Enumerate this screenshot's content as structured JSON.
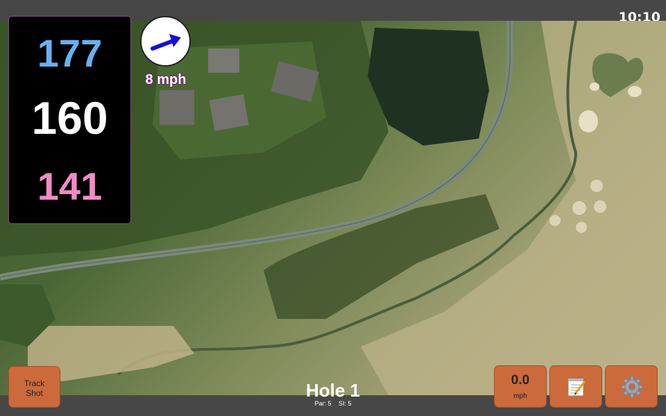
{
  "status_bar": {
    "time": "10:10"
  },
  "distances": {
    "back": "177",
    "center": "160",
    "front": "141"
  },
  "wind": {
    "speed": "8 mph",
    "icon": "wind-direction-arrow-icon"
  },
  "buttons": {
    "track_shot": {
      "line1": "Track",
      "line2": "Shot"
    },
    "speed": {
      "value": "0.0",
      "unit": "mph"
    },
    "notes": {
      "icon": "notepad-icon"
    },
    "settings": {
      "icon": "gear-icon"
    }
  },
  "hole": {
    "title": "Hole 1",
    "par": "Par: 5",
    "si": "SI: 5"
  },
  "colors": {
    "back_distance": "#6ab0f0",
    "center_distance": "#ffffff",
    "front_distance": "#f08cc4",
    "button": "#cc6a3c",
    "bar": "#474747"
  }
}
